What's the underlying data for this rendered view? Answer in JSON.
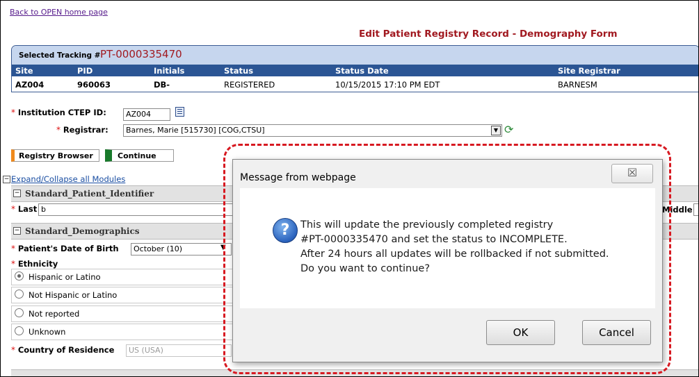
{
  "back_link": "Back to OPEN home page",
  "form_title": "Edit Patient Registry Record - Demography Form",
  "tracking": {
    "label": "Selected Tracking #",
    "value": "PT-0000335470",
    "headers": [
      "Site",
      "PID",
      "Initials",
      "Status",
      "Status Date",
      "Site Registrar"
    ],
    "row": [
      "AZ004",
      "960063",
      "DB-",
      "REGISTERED",
      "10/15/2015 17:10 PM EDT",
      "BARNESM"
    ]
  },
  "institution": {
    "required_mark": "*",
    "label": "Institution CTEP ID:",
    "value": "AZ004"
  },
  "registrar": {
    "required_mark": "*",
    "label": "Registrar:",
    "value": "Barnes, Marie [515730] [COG,CTSU]"
  },
  "buttons": {
    "registry_browser": "Registry Browser",
    "continue": "Continue"
  },
  "expand_collapse": "Expand/Collapse all Modules",
  "sections": {
    "identifier": "Standard_Patient_Identifier",
    "demographics": "Standard_Demographics"
  },
  "fields": {
    "last_label": "Last",
    "last_value": "b",
    "middle_label": "Middle",
    "dob_label": "Patient's Date of Birth",
    "dob_month": "October (10)",
    "ethnicity_label": "Ethnicity",
    "ethnicity_options": [
      "Hispanic or Latino",
      "Not Hispanic or Latino",
      "Not reported",
      "Unknown"
    ],
    "ethnicity_selected": "Hispanic or Latino",
    "country_label": "Country of Residence",
    "country_value": "US (USA)"
  },
  "dialog": {
    "title": "Message from webpage",
    "close_glyph": "☒",
    "lines": [
      "This will update the previously completed registry",
      "#PT-0000335470 and set the status to INCOMPLETE.",
      "After 24 hours all updates will be rollbacked if not submitted.",
      "Do you want to continue?"
    ],
    "ok": "OK",
    "cancel": "Cancel"
  },
  "colors": {
    "highlight": "#d71921",
    "title_red": "#a11920",
    "header_blue": "#2b5594"
  }
}
